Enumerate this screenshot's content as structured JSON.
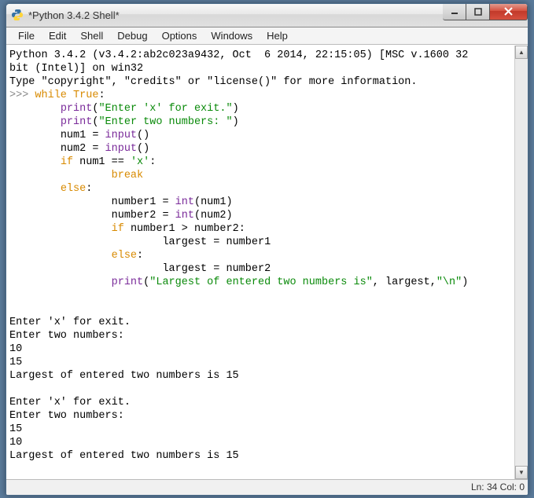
{
  "window": {
    "title": "*Python 3.4.2 Shell*"
  },
  "menu": {
    "items": [
      "File",
      "Edit",
      "Shell",
      "Debug",
      "Options",
      "Windows",
      "Help"
    ]
  },
  "code": {
    "header_line1": "Python 3.4.2 (v3.4.2:ab2c023a9432, Oct  6 2014, 22:15:05) [MSC v.1600 32",
    "header_line2": "bit (Intel)] on win32",
    "header_line3": "Type \"copyright\", \"credits\" or \"license()\" for more information.",
    "prompt": ">>> ",
    "tokens": {
      "while": "while",
      "true": "True",
      "print": "print",
      "input": "input",
      "int": "int",
      "if": "if",
      "else": "else",
      "break": "break",
      "str1": "\"Enter 'x' for exit.\"",
      "str2": "\"Enter two numbers: \"",
      "strx": "'x'",
      "str3": "\"Largest of entered two numbers is\"",
      "str4": "\"\\n\"",
      "num1": "num1",
      "num2": "num2",
      "number1": "number1",
      "number2": "number2",
      "largest": "largest",
      "eq": " = ",
      "eqeq": " == ",
      "gt": " > ",
      "colon": ":",
      "op": "(",
      "cp": ")",
      "comma_sp": ", ",
      "comma": ","
    },
    "output": [
      "",
      "",
      "Enter 'x' for exit.",
      "Enter two numbers: ",
      "10",
      "15",
      "Largest of entered two numbers is 15 ",
      "",
      "Enter 'x' for exit.",
      "Enter two numbers: ",
      "15",
      "10",
      "Largest of entered two numbers is 15 "
    ]
  },
  "status": {
    "text": "Ln: 34 Col: 0"
  },
  "indent": {
    "i1": "        ",
    "i2": "                ",
    "i3": "                        "
  }
}
